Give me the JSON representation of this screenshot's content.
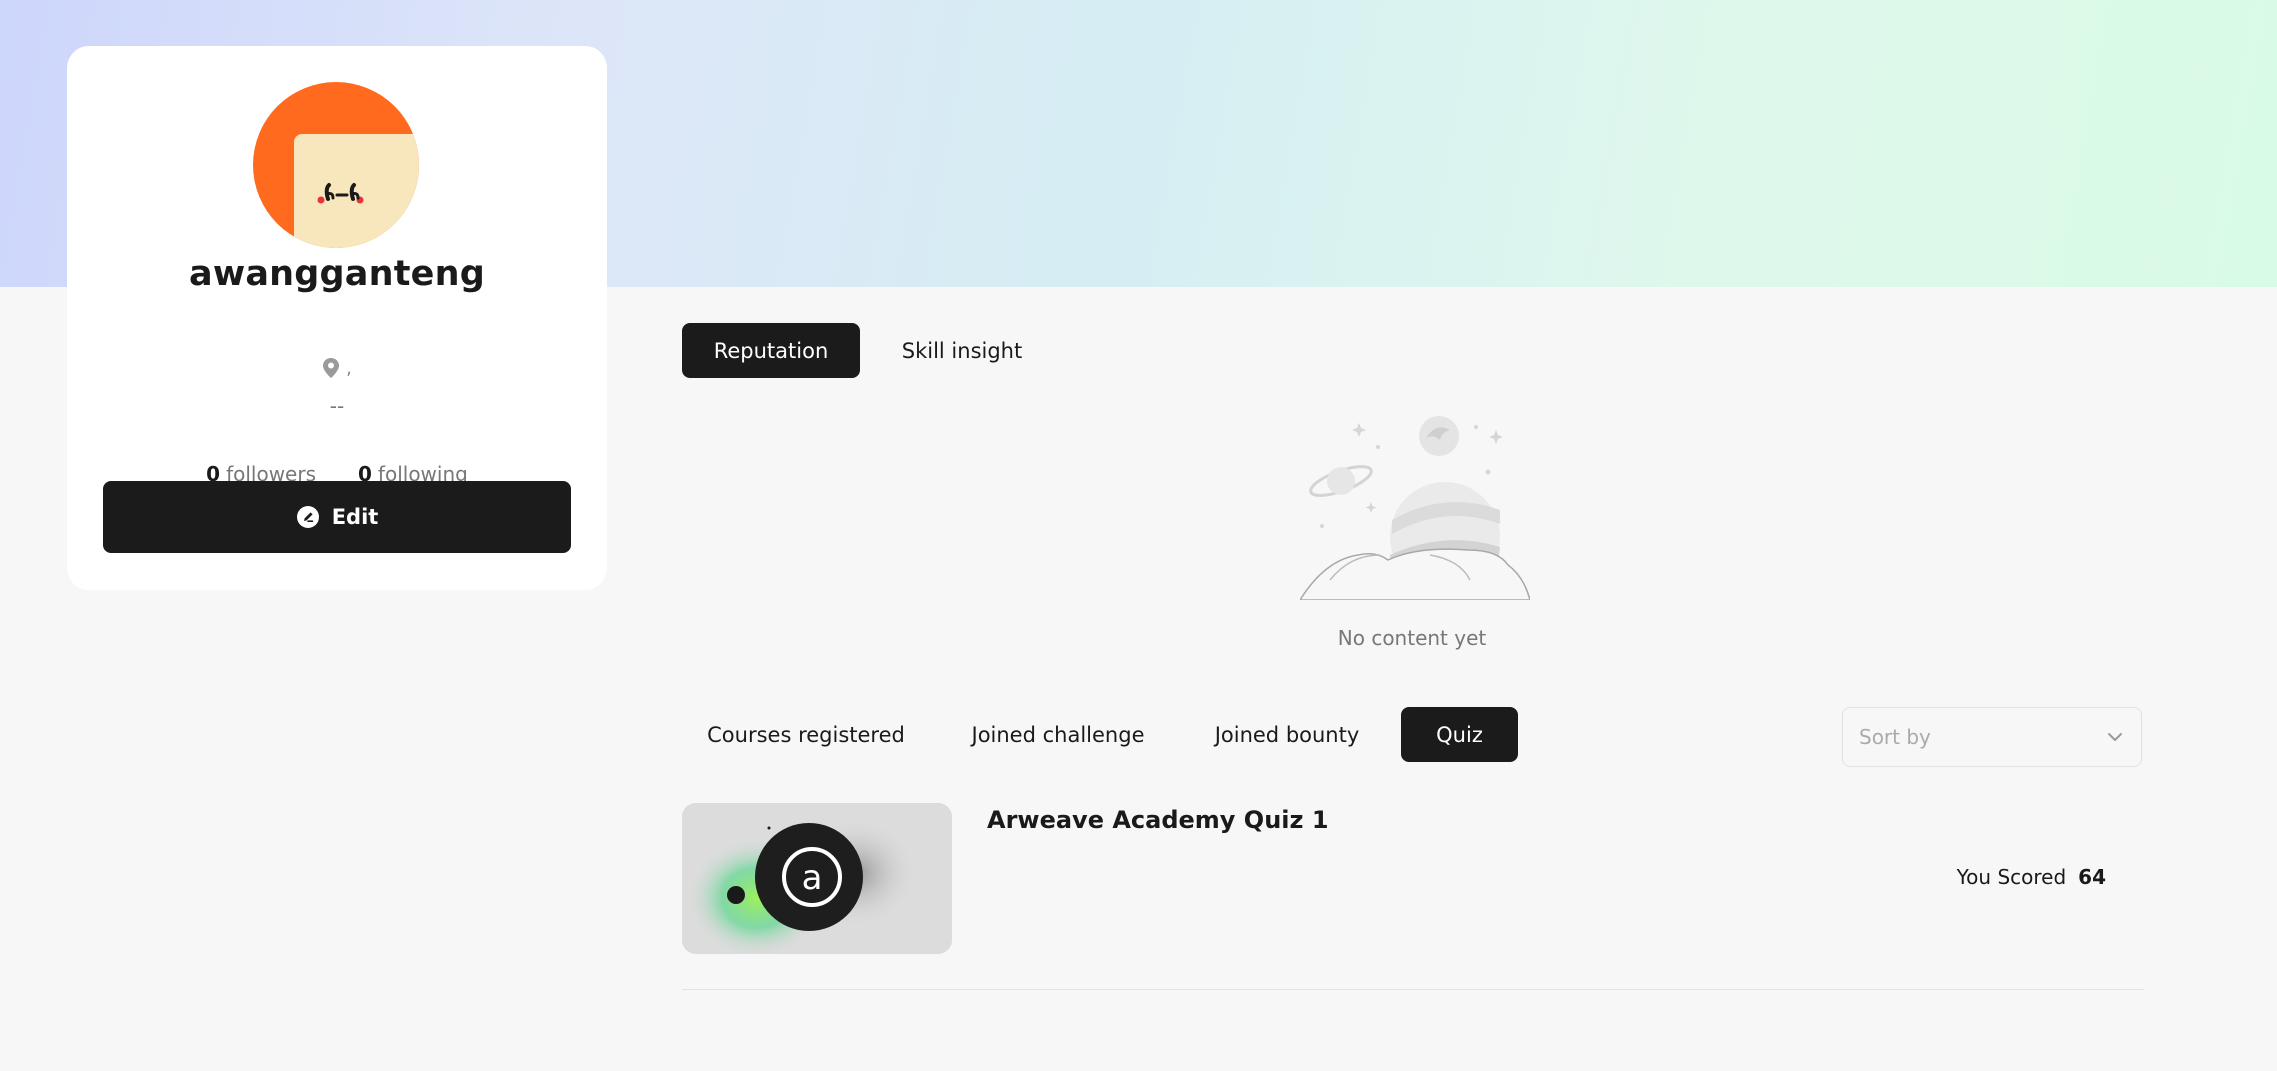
{
  "profile": {
    "username": "awangganteng",
    "location": ",",
    "bio": "--",
    "followers_count": "0",
    "followers_label": "followers",
    "following_count": "0",
    "following_label": "following",
    "edit_label": "Edit",
    "avatar_colors": {
      "background": "#ff6a1f",
      "face": "#f8e7bc"
    }
  },
  "top_tabs": [
    {
      "label": "Reputation",
      "active": true
    },
    {
      "label": "Skill insight",
      "active": false
    }
  ],
  "empty_state": {
    "text": "No content yet",
    "icon": "empty-planet-illustration"
  },
  "content_tabs": [
    {
      "label": "Courses registered",
      "active": false
    },
    {
      "label": "Joined challenge",
      "active": false
    },
    {
      "label": "Joined bounty",
      "active": false
    },
    {
      "label": "Quiz",
      "active": true
    }
  ],
  "sort": {
    "placeholder": "Sort by",
    "icon": "chevron-down-icon"
  },
  "quizzes": [
    {
      "title": "Arweave Academy Quiz 1",
      "score_label": "You Scored",
      "score": "64",
      "thumb_icon": "arweave-logo-icon"
    }
  ],
  "colors": {
    "accent_dark": "#1b1b1b",
    "banner_start": "#cdd6fb",
    "banner_end": "#d8fbe6"
  }
}
